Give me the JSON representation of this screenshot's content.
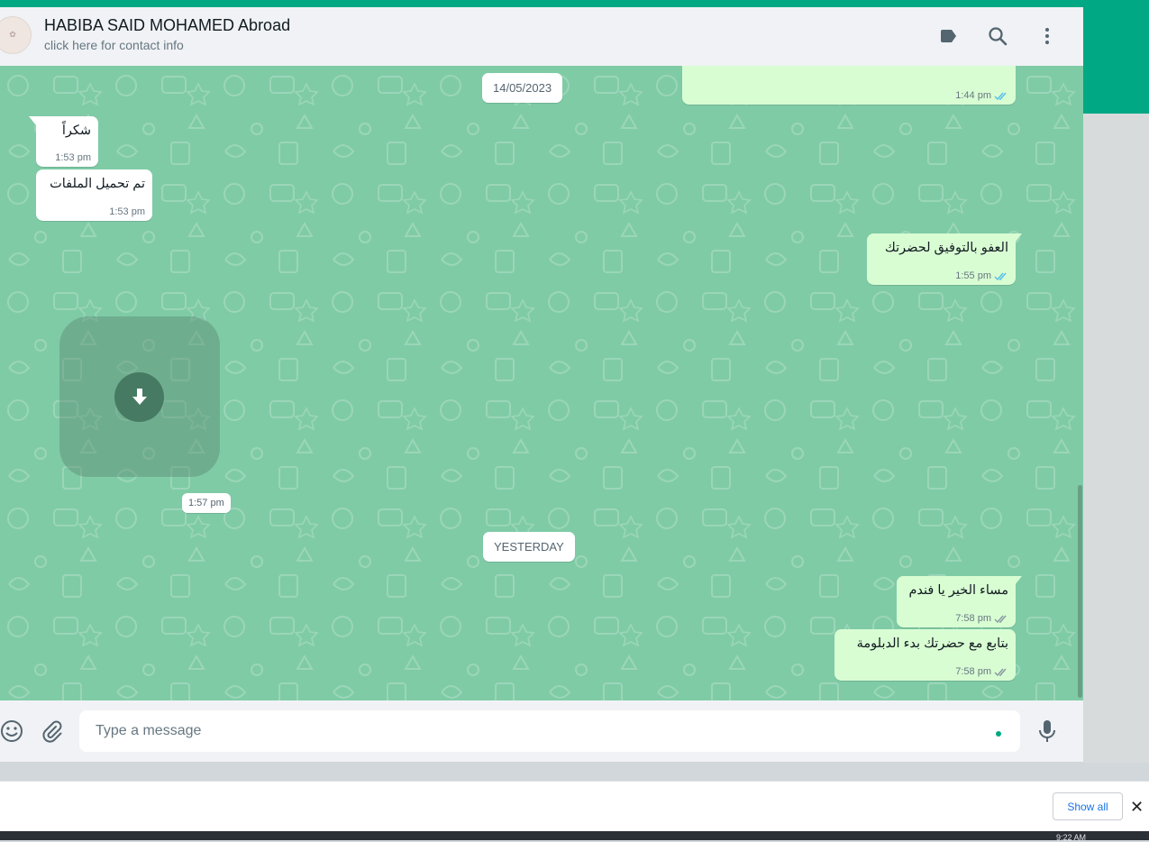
{
  "header": {
    "contact_name": "HABIBA SAID MOHAMED Abroad",
    "contact_sub": "click here for contact info",
    "icons": [
      "label-icon",
      "search-icon",
      "menu-icon"
    ]
  },
  "chat": {
    "date_chips": [
      "14/05/2023",
      "YESTERDAY"
    ],
    "messages": [
      {
        "dir": "out",
        "text": "",
        "time": "1:44 pm",
        "status": "read"
      },
      {
        "dir": "in",
        "text": "شكراً",
        "time": "1:53 pm"
      },
      {
        "dir": "in",
        "text": "تم تحميل الملفات",
        "time": "1:53 pm"
      },
      {
        "dir": "out",
        "text": "العفو بالتوفيق لحضرتك",
        "time": "1:55 pm",
        "status": "read"
      },
      {
        "dir": "in",
        "text": "",
        "time": "1:57 pm",
        "media": "download"
      },
      {
        "dir": "out",
        "text": "مساء الخير يا فندم",
        "time": "7:58 pm",
        "status": "delivered"
      },
      {
        "dir": "out",
        "text": "بتابع مع حضرتك بدء الدبلومة",
        "time": "7:58 pm",
        "status": "delivered"
      }
    ]
  },
  "composer": {
    "placeholder": "Type a message"
  },
  "download_bar": {
    "show_all_label": "Show all",
    "close_label": "✕"
  },
  "taskbar": {
    "time": "9:22 AM"
  },
  "colors": {
    "accent": "#00a884",
    "chat_bg": "#7fcba6",
    "out_bubble": "#d9fdd3",
    "read_tick": "#53bdeb",
    "delivered_tick": "#667781"
  }
}
